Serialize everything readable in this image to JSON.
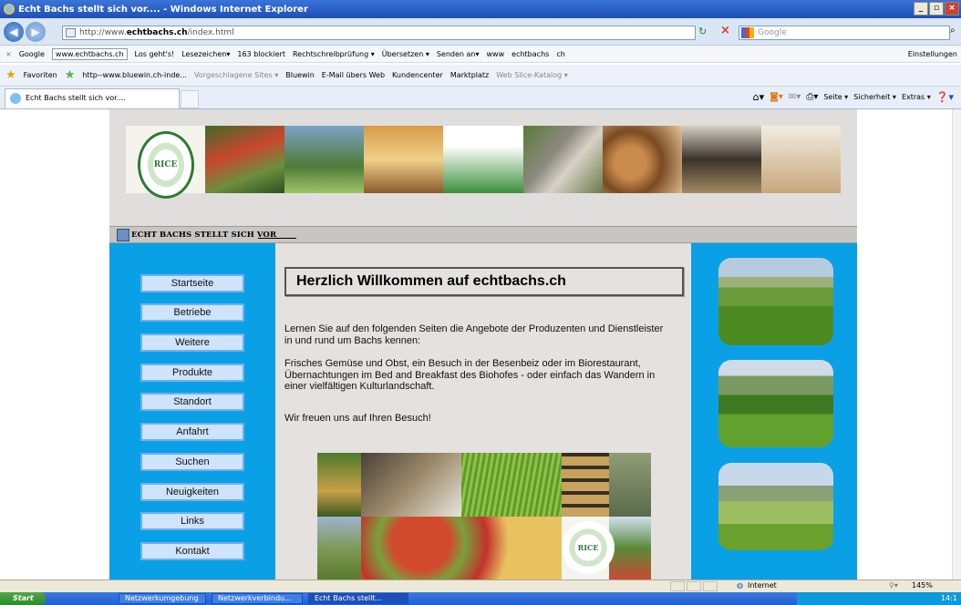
{
  "window": {
    "title": "Echt Bachs stellt sich vor.... - Windows Internet Explorer",
    "controls": [
      "_",
      "▫",
      "×"
    ]
  },
  "address": {
    "prefix": "http://www.",
    "domain": "echtbachs.ch",
    "path": "/index.html",
    "search_placeholder": "Google"
  },
  "google_toolbar": {
    "label": "Google",
    "query": "www.echtbachs.ch",
    "items": [
      "Los geht's!",
      "Lesezeichen▾",
      "163 blockiert",
      "Rechtschreibprüfung ▾",
      "Übersetzen ▾",
      "Senden an▾",
      "www",
      "echtbachs",
      "ch"
    ],
    "settings": "Einstellungen"
  },
  "favorites": {
    "label": "Favoriten",
    "items": [
      "http--www.bluewin.ch-inde...",
      "Vorgeschlagene Sites ▾",
      "Bluewin",
      "E-Mail übers Web",
      "Kundencenter",
      "Marktplatz",
      "Web Slice-Katalog ▾"
    ]
  },
  "tab": {
    "title": "Echt Bachs stellt sich vor...."
  },
  "commandbar": {
    "items": [
      "Seite ▾",
      "Sicherheit ▾",
      "Extras ▾"
    ]
  },
  "site": {
    "logo_text": "RICE",
    "section_title": "ECHT BACHS STELLT SICH VOR",
    "nav": [
      "Startseite",
      "Betriebe",
      "Weitere",
      "Produkte",
      "Standort",
      "Anfahrt",
      "Suchen",
      "Neuigkeiten",
      "Links",
      "Kontakt"
    ],
    "heading": "Herzlich Willkommen auf echtbachs.ch",
    "paragraphs": [
      "Lernen Sie auf den folgenden Seiten die Angebote der Produzenten und Dienstleister in und rund um Bachs kennen:",
      "Frisches Gemüse und Obst, ein Besuch in der Besenbeiz oder im Biorestaurant, Übernachtungen im Bed and Breakfast des Biohofes - oder einfach das Wandern in einer vielfältigen Kulturlandschaft.",
      "Wir freuen uns auf Ihren Besuch!"
    ],
    "collage_logo": "RICE"
  },
  "status": {
    "zone": "Internet",
    "zoom": "145%"
  },
  "taskbar": {
    "start": "Start",
    "tasks": [
      "Netzwerkumgebung",
      "Netzwerkverbindu...",
      "Echt Bachs stellt..."
    ],
    "clock": "14:1"
  }
}
